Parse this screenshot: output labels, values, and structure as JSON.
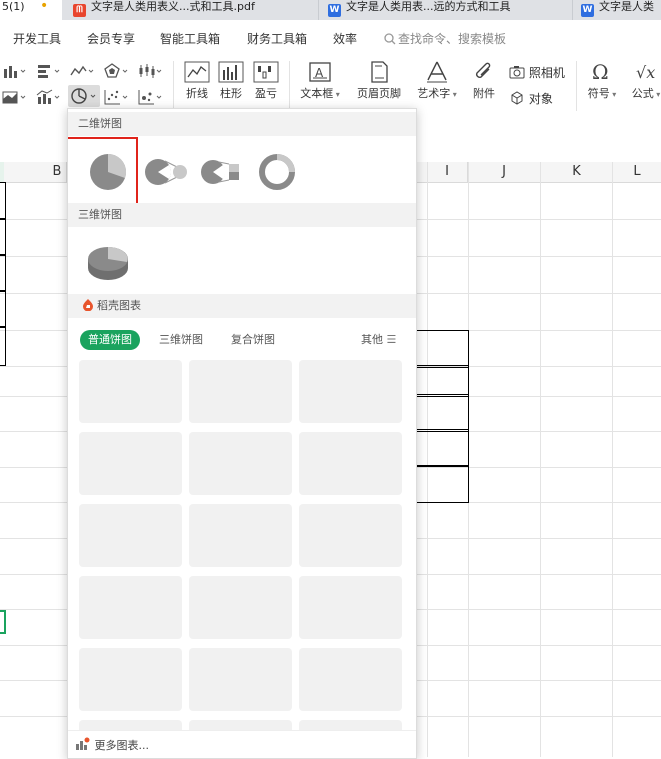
{
  "tabs": [
    {
      "label": "5(1)",
      "kind": "none"
    },
    {
      "label": "•",
      "kind": "dot"
    },
    {
      "label": "文字是人类用表义...式和工具.pdf",
      "kind": "pdf"
    },
    {
      "label": "文字是人类用表...远的方式和工具",
      "kind": "word"
    },
    {
      "label": "文字是人类",
      "kind": "word"
    }
  ],
  "menu": {
    "items": [
      "开发工具",
      "会员专享",
      "智能工具箱",
      "财务工具箱",
      "效率"
    ],
    "search_placeholder": "查找命令、搜索模板"
  },
  "ribbon": {
    "sparklines": [
      {
        "label": "折线",
        "icon": "sparkline-line-icon"
      },
      {
        "label": "柱形",
        "icon": "sparkline-column-icon"
      },
      {
        "label": "盈亏",
        "icon": "sparkline-winloss-icon"
      }
    ],
    "textbox": "文本框",
    "header_footer": "页眉页脚",
    "wordart": "艺术字",
    "attachment": "附件",
    "camera": "照相机",
    "object": "对象",
    "symbol": "符号",
    "formula": "公式"
  },
  "sheet": {
    "columns": [
      "B",
      "I",
      "J",
      "K",
      "L"
    ]
  },
  "dropdown": {
    "section_2d": "二维饼图",
    "section_3d": "三维饼图",
    "section_template": "稻壳图表",
    "chart_options_2d": [
      "pie-chart-icon",
      "pie-of-pie-icon",
      "bar-of-pie-icon",
      "doughnut-chart-icon"
    ],
    "chart_options_3d": [
      "3d-pie-chart-icon"
    ],
    "template_tabs": [
      "普通饼图",
      "三维饼图",
      "复合饼图"
    ],
    "other_label": "其他",
    "more_charts": "更多图表..."
  },
  "colors": {
    "accent_green": "#1aa35e",
    "highlight_red": "#e0241b",
    "docer_orange": "#e8552d"
  }
}
